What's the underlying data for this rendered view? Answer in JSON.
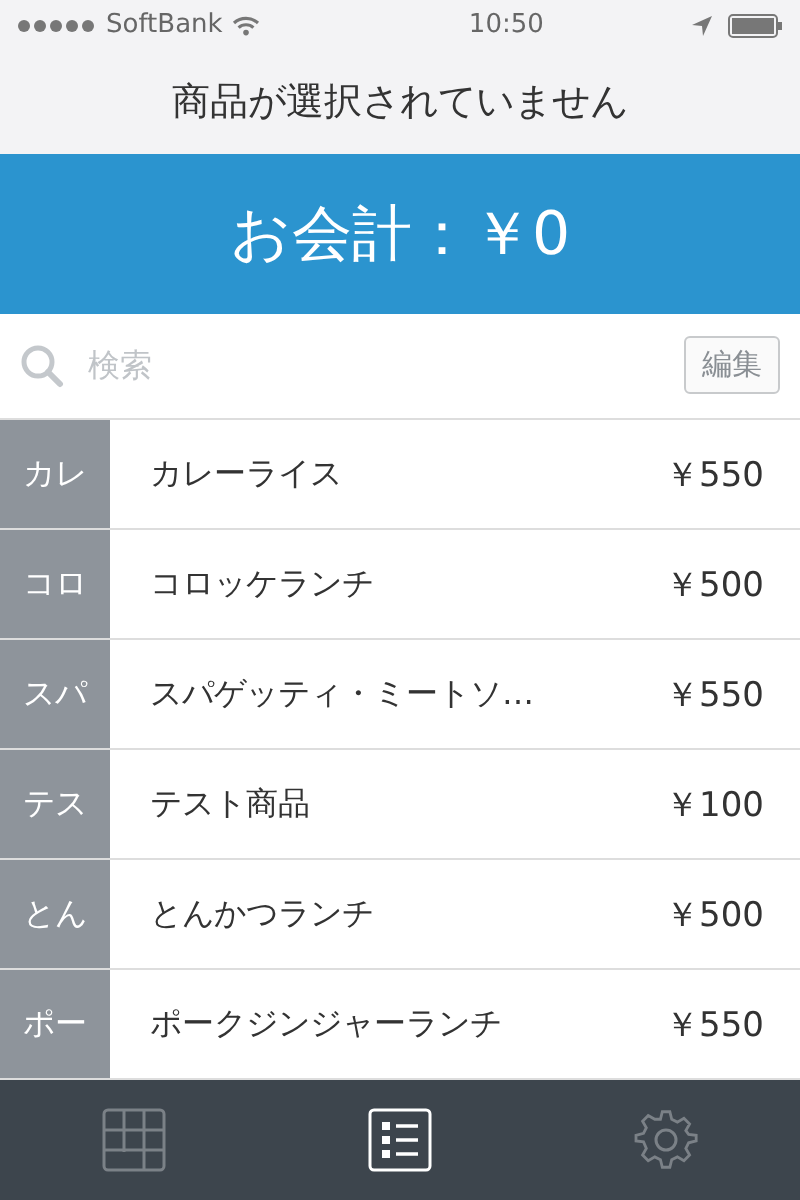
{
  "status_bar": {
    "carrier": "SoftBank",
    "time": "10:50"
  },
  "title": "商品が選択されていません",
  "total": "お会計：￥0",
  "search": {
    "placeholder": "検索"
  },
  "edit_button": "編集",
  "products": [
    {
      "index": "カレ",
      "name": "カレーライス",
      "price": "￥550"
    },
    {
      "index": "コロ",
      "name": "コロッケランチ",
      "price": "￥500"
    },
    {
      "index": "スパ",
      "name": "スパゲッティ・ミートソ…",
      "price": "￥550"
    },
    {
      "index": "テス",
      "name": "テスト商品",
      "price": "￥100"
    },
    {
      "index": "とん",
      "name": "とんかつランチ",
      "price": "￥500"
    },
    {
      "index": "ポー",
      "name": "ポークジンジャーランチ",
      "price": "￥550"
    }
  ],
  "tabs": [
    {
      "kind": "grid",
      "selected": false
    },
    {
      "kind": "list",
      "selected": true
    },
    {
      "kind": "settings",
      "selected": false
    }
  ]
}
